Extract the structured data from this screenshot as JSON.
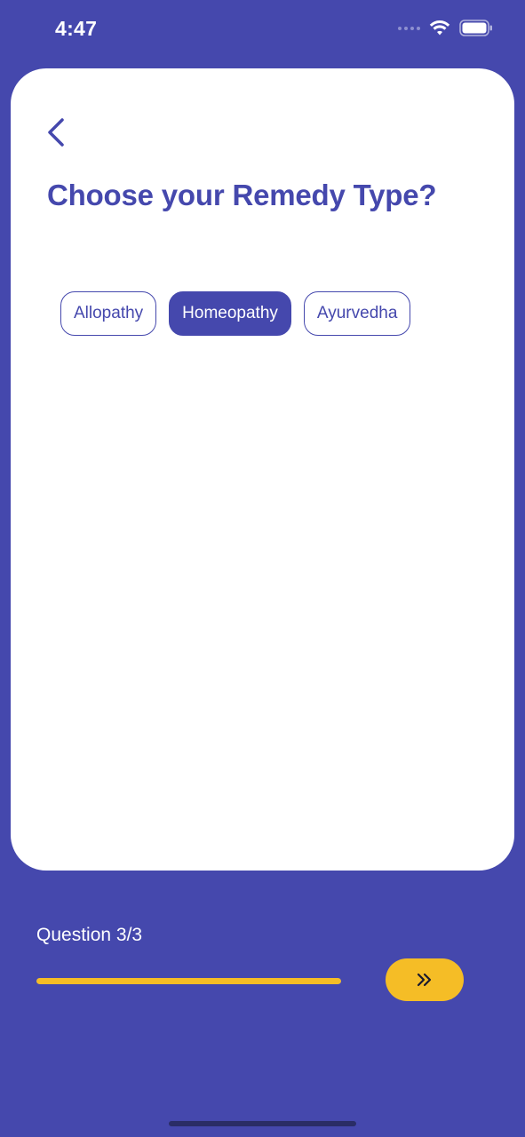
{
  "status_bar": {
    "time": "4:47"
  },
  "screen": {
    "title": "Choose your Remedy Type?",
    "options": [
      {
        "label": "Allopathy",
        "selected": false
      },
      {
        "label": "Homeopathy",
        "selected": true
      },
      {
        "label": "Ayurvedha",
        "selected": false
      }
    ]
  },
  "footer": {
    "question_label": "Question 3/3",
    "progress": 1.0
  },
  "colors": {
    "primary": "#4548ad",
    "accent": "#f5bd26",
    "card": "#ffffff"
  },
  "icons": {
    "back": "chevron-left-icon",
    "next": "double-chevron-right-icon"
  }
}
